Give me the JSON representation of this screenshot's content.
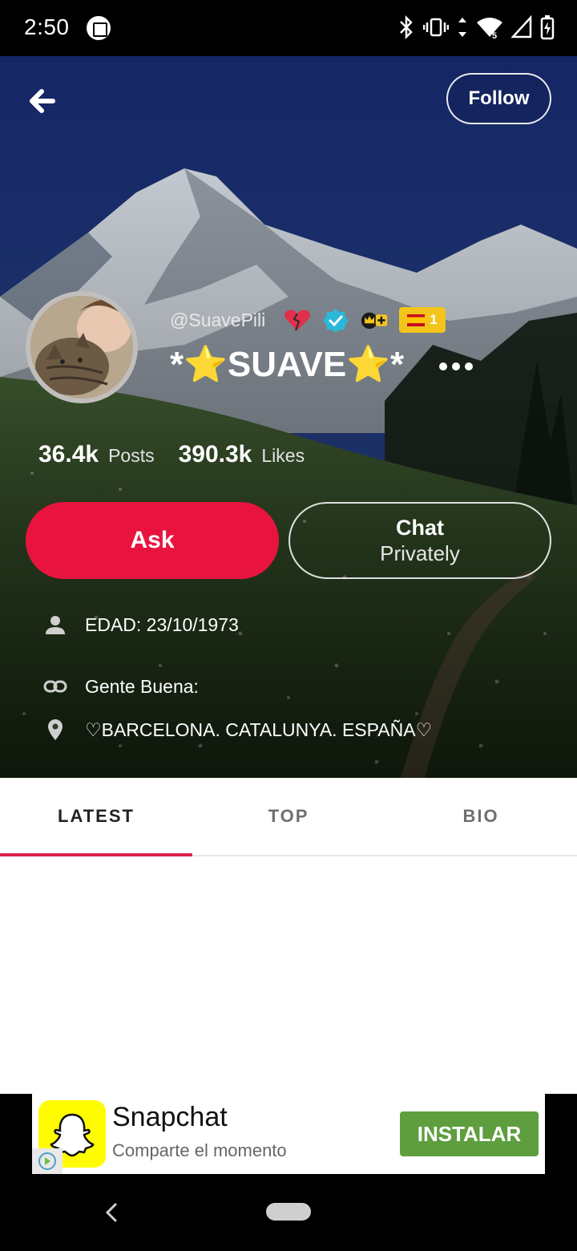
{
  "status_bar": {
    "time": "2:50",
    "icons": [
      "media-icon",
      "bluetooth-icon",
      "vibrate-icon",
      "data-arrows-icon",
      "wifi-icon",
      "signal-icon",
      "battery-icon"
    ]
  },
  "header": {
    "follow_label": "Follow"
  },
  "profile": {
    "handle": "@SuavePili",
    "display_name": "*⭐SUAVE⭐*",
    "badges": [
      "broken-heart-icon",
      "verified-icon",
      "crown-plus-icon",
      "spain-flag-badge"
    ],
    "flag_badge_count": "1",
    "stats": {
      "posts_count": "36.4k",
      "posts_label": "Posts",
      "likes_count": "390.3k",
      "likes_label": "Likes"
    },
    "ask_label": "Ask",
    "chat_line1": "Chat",
    "chat_line2": "Privately",
    "info": {
      "age": "EDAD: 23/10/1973",
      "link": "Gente Buena:",
      "location": "♡BARCELONA. CATALUNYA. ESPAÑA♡"
    }
  },
  "tabs": [
    {
      "label": "LATEST",
      "active": true
    },
    {
      "label": "TOP",
      "active": false
    },
    {
      "label": "BIO",
      "active": false
    }
  ],
  "ad": {
    "title": "Snapchat",
    "subtitle": "Comparte el momento",
    "install_label": "INSTALAR"
  },
  "colors": {
    "accent": "#e8143f",
    "tab_indicator": "#e0234a",
    "install_green": "#5e9e3f",
    "snapchat_yellow": "#fffc00"
  }
}
